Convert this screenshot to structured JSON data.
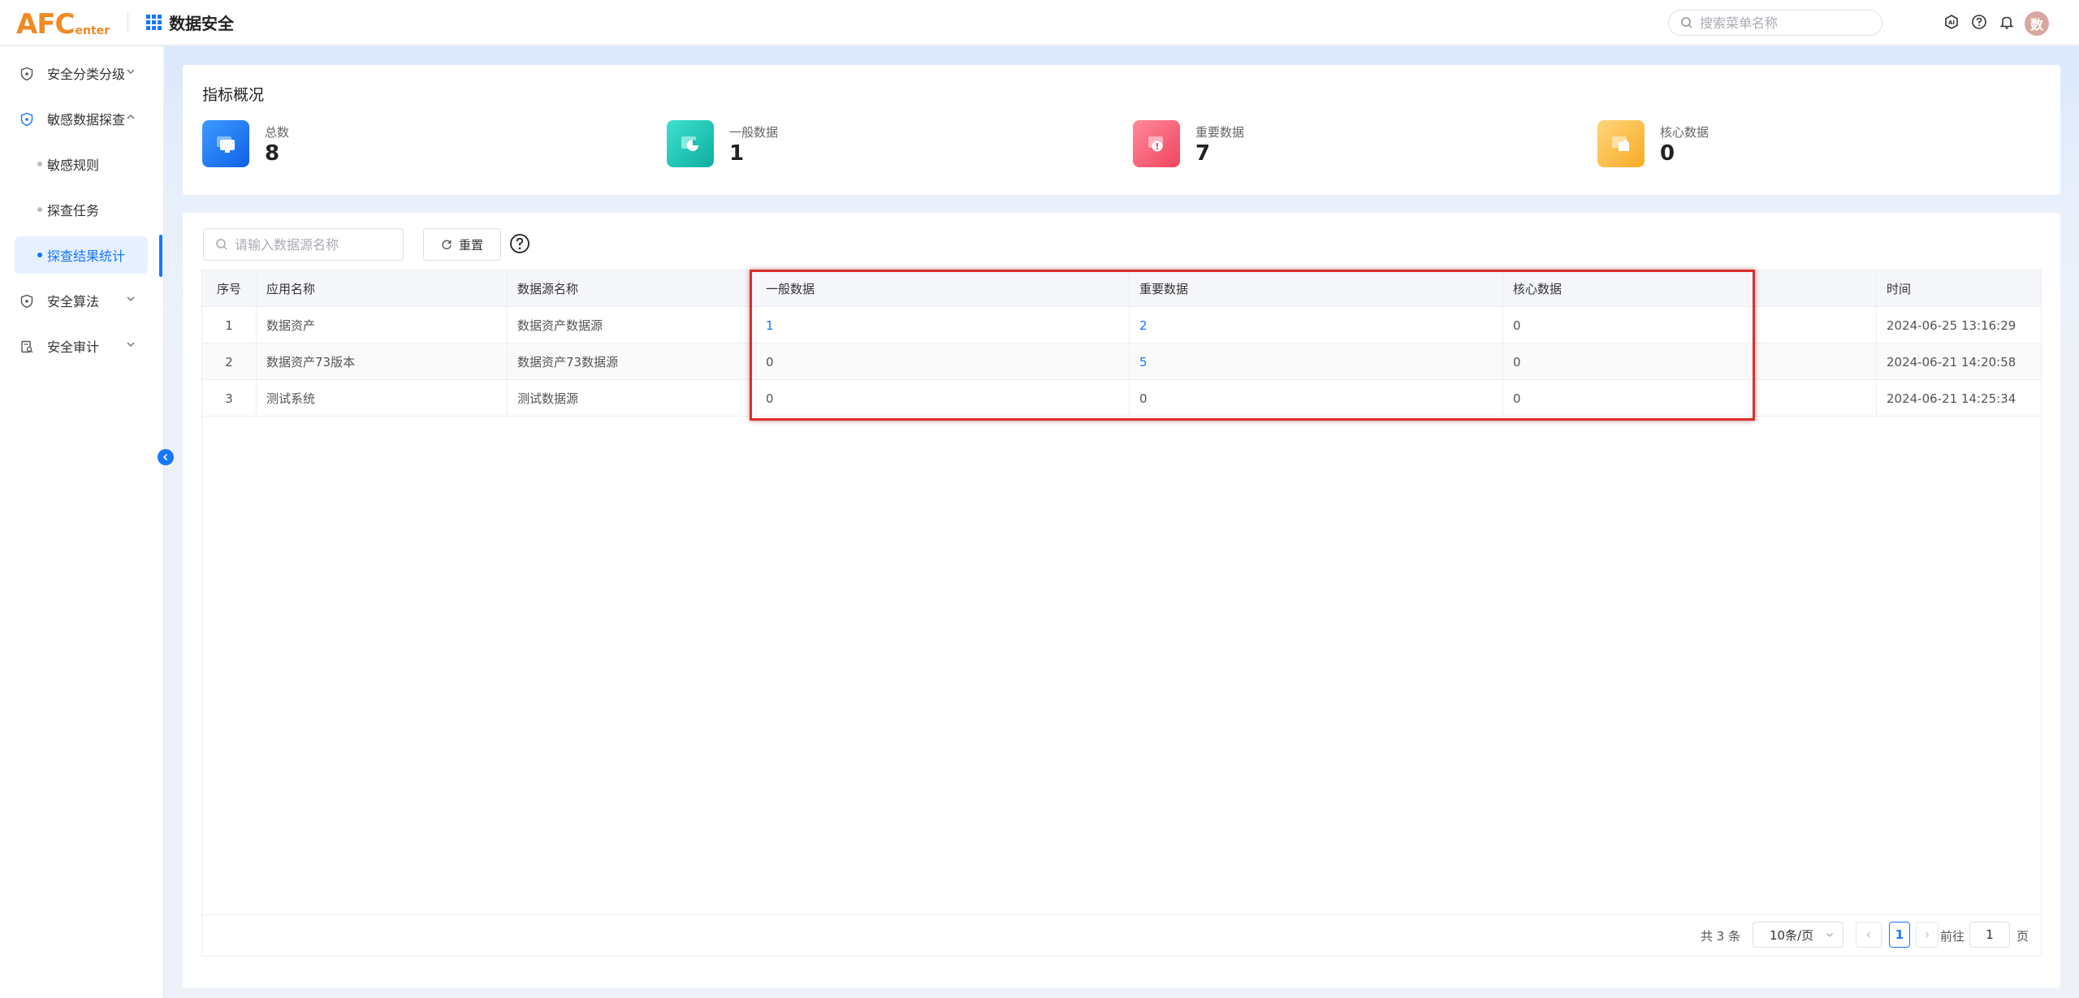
{
  "header": {
    "logo_main": "AFC",
    "logo_sub": "enter",
    "app_title": "数据安全",
    "search_placeholder": "搜索菜单名称",
    "avatar_text": "数"
  },
  "sidebar": {
    "items": [
      {
        "label": "安全分类分级"
      },
      {
        "label": "敏感数据探查"
      },
      {
        "label": "安全算法"
      },
      {
        "label": "安全审计"
      }
    ],
    "sub_items": [
      {
        "label": "敏感规则"
      },
      {
        "label": "探查任务"
      },
      {
        "label": "探查结果统计"
      }
    ]
  },
  "overview": {
    "title": "指标概况",
    "stats": [
      {
        "label": "总数",
        "value": "8",
        "color": "#1677ff"
      },
      {
        "label": "一般数据",
        "value": "1",
        "color": "#13c2b3"
      },
      {
        "label": "重要数据",
        "value": "7",
        "color": "#f5576c"
      },
      {
        "label": "核心数据",
        "value": "0",
        "color": "#fcb93b"
      }
    ]
  },
  "filter": {
    "placeholder": "请输入数据源名称",
    "reset_label": "重置"
  },
  "table": {
    "headers": [
      "序号",
      "应用名称",
      "数据源名称",
      "一般数据",
      "重要数据",
      "核心数据",
      "时间"
    ],
    "rows": [
      [
        "1",
        "数据资产",
        "数据资产数据源",
        "1",
        "2",
        "0",
        "2024-06-25 13:16:29"
      ],
      [
        "2",
        "数据资产73版本",
        "数据资产73数据源",
        "0",
        "5",
        "0",
        "2024-06-21 14:20:58"
      ],
      [
        "3",
        "测试系统",
        "测试数据源",
        "0",
        "0",
        "0",
        "2024-06-21 14:25:34"
      ]
    ]
  },
  "pagination": {
    "total": "共 3 条",
    "page_size": "10条/页",
    "current": "1",
    "goto_label": "前往",
    "goto_value": "1",
    "page_label": "页"
  }
}
